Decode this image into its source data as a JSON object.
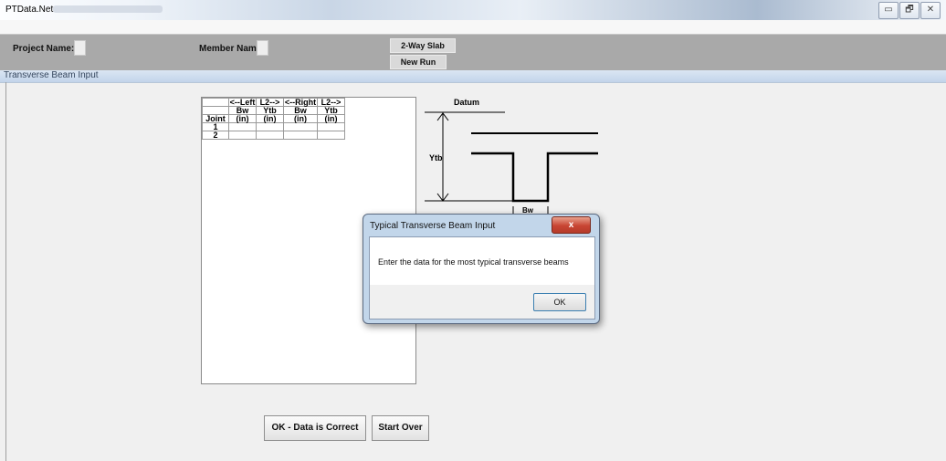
{
  "window": {
    "title": "PTData.Net",
    "buttons": {
      "minimize": "▭",
      "maximize": "🗗",
      "close": "✕"
    }
  },
  "header": {
    "project_label": "Project Name:",
    "member_label": "Member Name:",
    "type_button": "2-Way Slab",
    "new_run_button": "New Run"
  },
  "section": {
    "title": "Transverse Beam Input"
  },
  "grid": {
    "header_rows": [
      [
        "",
        "<--Left",
        "L2-->",
        "<--Right",
        "L2-->"
      ],
      [
        "",
        "Bw",
        "Ytb",
        "Bw",
        "Ytb"
      ],
      [
        "Joint",
        "(in)",
        "(in)",
        "(in)",
        "(in)"
      ]
    ],
    "rows": [
      {
        "joint": "1",
        "values": [
          "",
          "",
          "",
          ""
        ]
      },
      {
        "joint": "2",
        "values": [
          "",
          "",
          "",
          ""
        ]
      }
    ]
  },
  "diagram": {
    "datum": "Datum",
    "ytb": "Ytb",
    "bw": "Bw"
  },
  "dialog": {
    "title": "Typical Transverse Beam Input",
    "close": "x",
    "message": "Enter the data for the most typical transverse beams",
    "ok": "OK"
  },
  "actions": {
    "ok_button": "OK - Data is Correct",
    "start_over_button": "Start Over"
  }
}
